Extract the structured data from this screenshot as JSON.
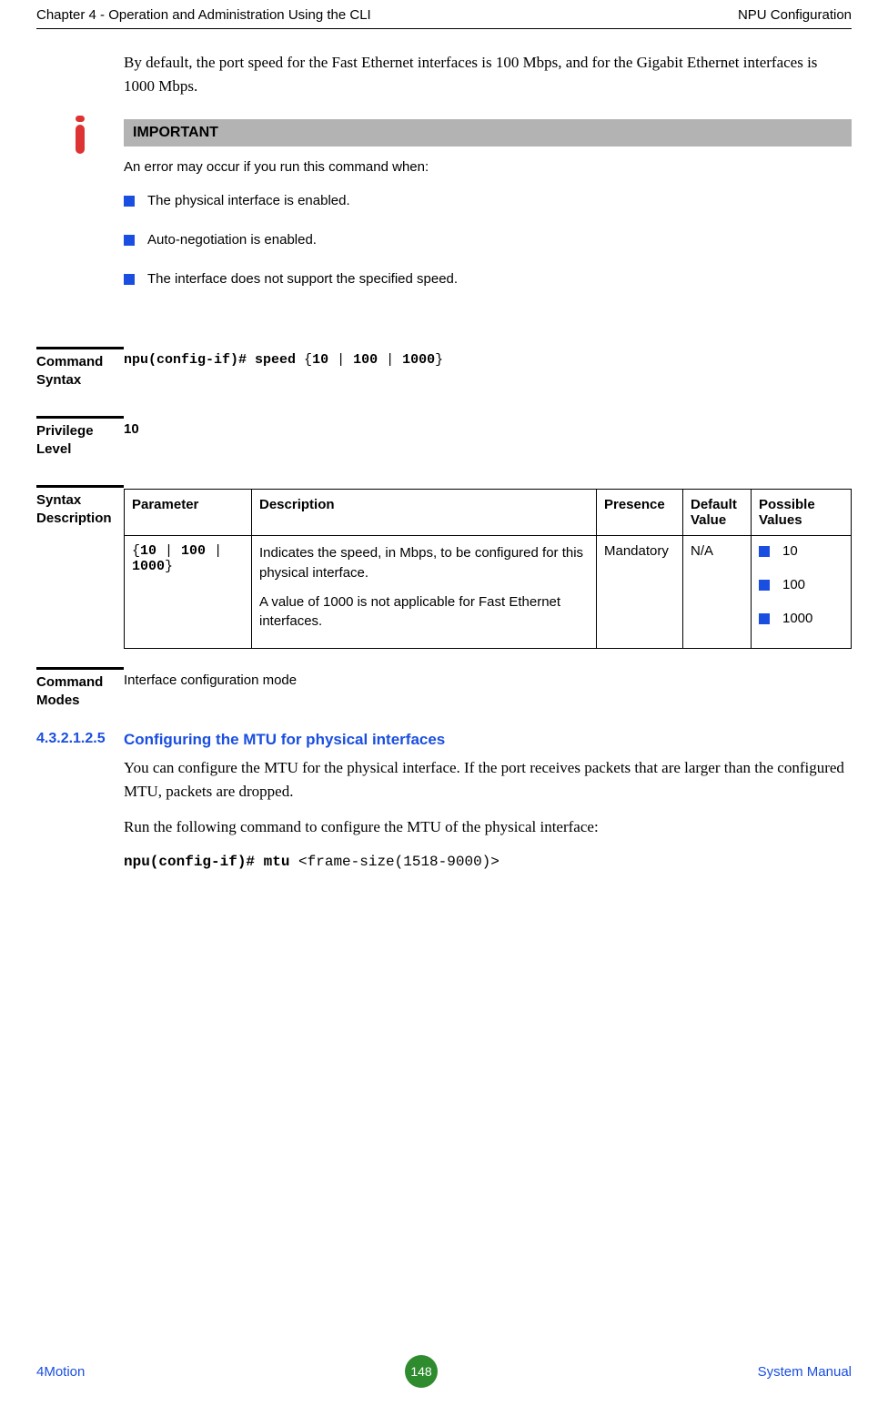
{
  "header": {
    "left": "Chapter 4 - Operation and Administration Using the CLI",
    "right": "NPU Configuration"
  },
  "intro": "By default, the port speed for the Fast Ethernet interfaces is 100 Mbps, and for the Gigabit Ethernet interfaces is 1000 Mbps.",
  "callout": {
    "title": "IMPORTANT",
    "lead": "An error may occur if you run this command when:",
    "items": [
      "The physical interface is enabled.",
      "Auto-negotiation is enabled.",
      "The interface does not support the specified speed."
    ]
  },
  "command_syntax": {
    "label": "Command Syntax",
    "prefix": "npu(config-if)# speed ",
    "brace_open": "{",
    "opt1": "10",
    "sep1": " | ",
    "opt2": "100",
    "sep2": " | ",
    "opt3": "1000",
    "brace_close": "}"
  },
  "privilege": {
    "label": "Privilege Level",
    "value": "10"
  },
  "syntax_desc": {
    "label": "Syntax Description",
    "headers": {
      "param": "Parameter",
      "desc": "Description",
      "presence": "Presence",
      "default": "Default Value",
      "possible": "Possible Values"
    },
    "row": {
      "param_open": "{",
      "param_a": "10",
      "param_s1": " | ",
      "param_b": "100",
      "param_s2": " | ",
      "param_c": "1000",
      "param_close": "}",
      "desc1": "Indicates the speed, in Mbps, to be configured for this physical interface.",
      "desc2": "A value of 1000 is not applicable for Fast Ethernet interfaces.",
      "presence": "Mandatory",
      "default": "N/A",
      "possible": [
        "10",
        "100",
        "1000"
      ]
    }
  },
  "command_modes": {
    "label": "Command Modes",
    "value": "Interface configuration mode"
  },
  "subheading": {
    "number": "4.3.2.1.2.5",
    "title": "Configuring the MTU for physical interfaces"
  },
  "mtu_para1": "You can configure the MTU for the physical interface. If the port receives packets that are larger than the configured MTU, packets are dropped.",
  "mtu_para2": "Run the following command to configure the MTU of the physical interface:",
  "mtu_cmd_prefix": "npu(config-if)# mtu ",
  "mtu_cmd_arg": "<frame-size(1518-9000)>",
  "footer": {
    "left": "4Motion",
    "page": "148",
    "right": "System Manual"
  }
}
